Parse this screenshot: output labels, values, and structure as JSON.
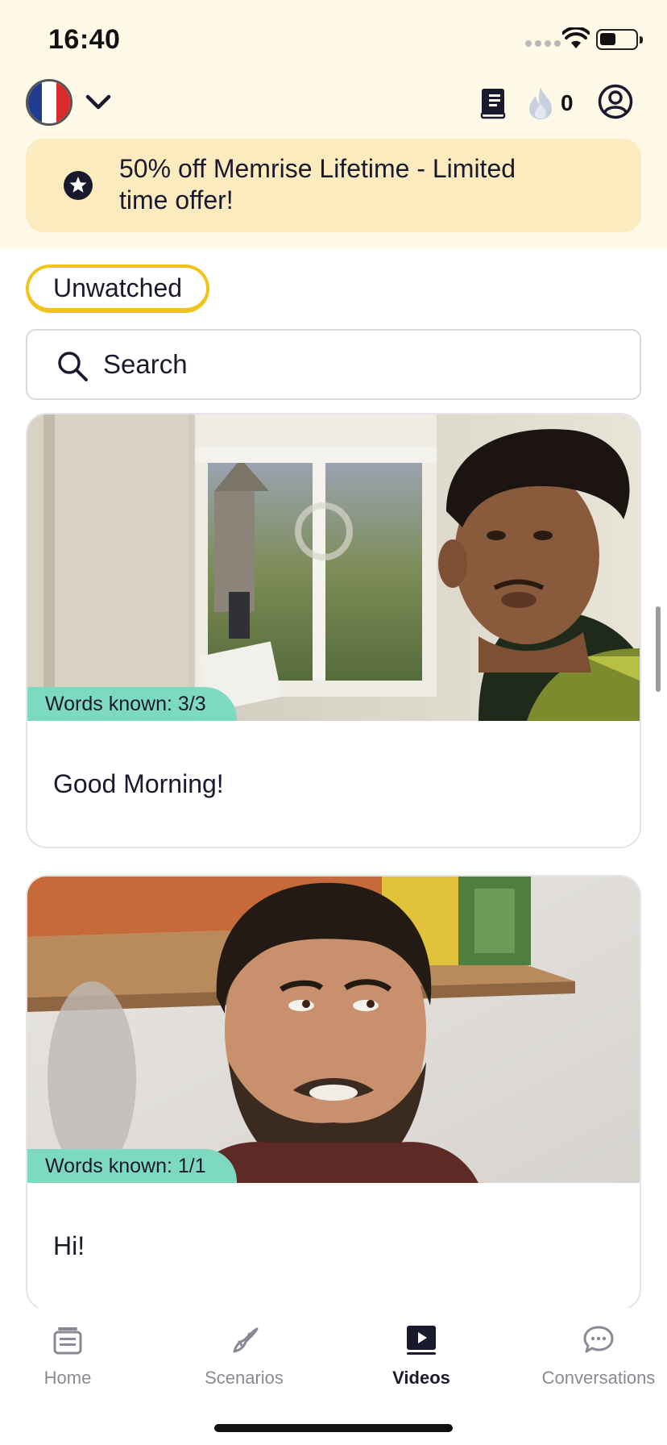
{
  "status_bar": {
    "time": "16:40",
    "battery_level": 0.45
  },
  "header": {
    "language_flag_icon": "france-flag-icon",
    "flag_colors": [
      "#1f3c91",
      "#ffffff",
      "#d92b2b"
    ],
    "streak_count": "0"
  },
  "promo": {
    "text": "50% off Memrise Lifetime - Limited time offer!"
  },
  "filter": {
    "label": "Unwatched"
  },
  "search": {
    "placeholder": "Search",
    "value": ""
  },
  "videos": [
    {
      "title": "Good Morning!",
      "words_known": "Words known: 3/3"
    },
    {
      "title": "Hi!",
      "words_known": "Words known: 1/1"
    }
  ],
  "tabs": [
    {
      "label": "Home",
      "icon": "home-icon",
      "active": false
    },
    {
      "label": "Scenarios",
      "icon": "scenarios-icon",
      "active": false
    },
    {
      "label": "Videos",
      "icon": "videos-icon",
      "active": true
    },
    {
      "label": "Conversations",
      "icon": "conversations-icon",
      "active": false
    }
  ],
  "colors": {
    "accent_yellow": "#f0c419",
    "badge_green": "#7dd9c0",
    "promo_bg": "#fdebc0",
    "header_bg": "#fff9e8"
  }
}
